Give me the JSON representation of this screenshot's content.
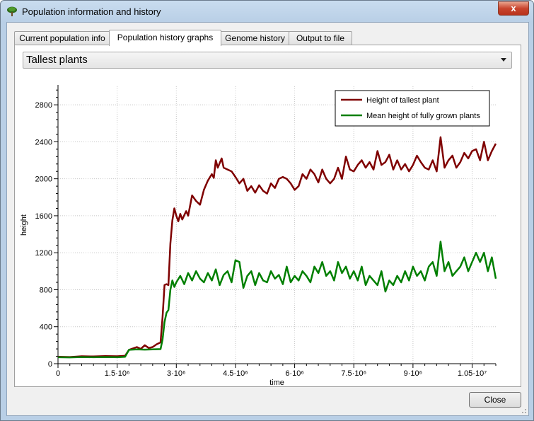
{
  "window": {
    "title": "Population information and history",
    "close_symbol": "x"
  },
  "tabs": [
    {
      "label": "Current population info",
      "active": false
    },
    {
      "label": "Population history graphs",
      "active": true
    },
    {
      "label": "Genome history",
      "active": false
    },
    {
      "label": "Output to file",
      "active": false
    }
  ],
  "graph_selector": {
    "selected": "Tallest plants"
  },
  "buttons": {
    "close": "Close"
  },
  "chart_data": {
    "type": "line",
    "xlabel": "time",
    "ylabel": "height",
    "xlim": [
      0,
      11100000
    ],
    "ylim": [
      0,
      3000
    ],
    "x_ticks": [
      {
        "value": 0,
        "label": "0"
      },
      {
        "value": 1500000,
        "label": "1.5·10⁶"
      },
      {
        "value": 3000000,
        "label": "3·10⁶"
      },
      {
        "value": 4500000,
        "label": "4.5·10⁶"
      },
      {
        "value": 6000000,
        "label": "6·10⁶"
      },
      {
        "value": 7500000,
        "label": "7.5·10⁶"
      },
      {
        "value": 9000000,
        "label": "9·10⁶"
      },
      {
        "value": 10500000,
        "label": "1.05·10⁷"
      }
    ],
    "y_ticks": [
      0,
      400,
      800,
      1200,
      1600,
      2000,
      2400,
      2800
    ],
    "grid": true,
    "legend_position": "top-right",
    "series": [
      {
        "name": "Height of tallest plant",
        "color": "#7f0000",
        "points": [
          [
            0,
            75
          ],
          [
            300000,
            72
          ],
          [
            600000,
            80
          ],
          [
            900000,
            78
          ],
          [
            1200000,
            82
          ],
          [
            1500000,
            80
          ],
          [
            1700000,
            85
          ],
          [
            1800000,
            150
          ],
          [
            2000000,
            180
          ],
          [
            2100000,
            160
          ],
          [
            2200000,
            200
          ],
          [
            2300000,
            170
          ],
          [
            2400000,
            180
          ],
          [
            2500000,
            210
          ],
          [
            2600000,
            230
          ],
          [
            2650000,
            500
          ],
          [
            2700000,
            850
          ],
          [
            2750000,
            860
          ],
          [
            2800000,
            850
          ],
          [
            2850000,
            1300
          ],
          [
            2900000,
            1550
          ],
          [
            2950000,
            1680
          ],
          [
            3000000,
            1600
          ],
          [
            3050000,
            1540
          ],
          [
            3100000,
            1620
          ],
          [
            3150000,
            1560
          ],
          [
            3250000,
            1650
          ],
          [
            3300000,
            1600
          ],
          [
            3400000,
            1820
          ],
          [
            3500000,
            1760
          ],
          [
            3600000,
            1720
          ],
          [
            3700000,
            1880
          ],
          [
            3800000,
            1980
          ],
          [
            3900000,
            2050
          ],
          [
            3950000,
            2010
          ],
          [
            4000000,
            2200
          ],
          [
            4050000,
            2120
          ],
          [
            4150000,
            2220
          ],
          [
            4200000,
            2120
          ],
          [
            4300000,
            2100
          ],
          [
            4400000,
            2080
          ],
          [
            4500000,
            2020
          ],
          [
            4600000,
            1950
          ],
          [
            4700000,
            2000
          ],
          [
            4800000,
            1870
          ],
          [
            4900000,
            1920
          ],
          [
            5000000,
            1850
          ],
          [
            5100000,
            1930
          ],
          [
            5200000,
            1870
          ],
          [
            5300000,
            1840
          ],
          [
            5400000,
            1950
          ],
          [
            5500000,
            1900
          ],
          [
            5600000,
            2000
          ],
          [
            5700000,
            2020
          ],
          [
            5800000,
            2000
          ],
          [
            5900000,
            1950
          ],
          [
            6000000,
            1880
          ],
          [
            6100000,
            1920
          ],
          [
            6200000,
            2050
          ],
          [
            6300000,
            2000
          ],
          [
            6400000,
            2100
          ],
          [
            6500000,
            2050
          ],
          [
            6600000,
            1960
          ],
          [
            6700000,
            2100
          ],
          [
            6800000,
            2000
          ],
          [
            6900000,
            1950
          ],
          [
            7000000,
            2000
          ],
          [
            7100000,
            2120
          ],
          [
            7200000,
            2000
          ],
          [
            7300000,
            2240
          ],
          [
            7400000,
            2100
          ],
          [
            7500000,
            2080
          ],
          [
            7600000,
            2150
          ],
          [
            7700000,
            2200
          ],
          [
            7800000,
            2120
          ],
          [
            7900000,
            2180
          ],
          [
            8000000,
            2100
          ],
          [
            8100000,
            2300
          ],
          [
            8200000,
            2150
          ],
          [
            8300000,
            2180
          ],
          [
            8400000,
            2260
          ],
          [
            8500000,
            2100
          ],
          [
            8600000,
            2200
          ],
          [
            8700000,
            2100
          ],
          [
            8800000,
            2160
          ],
          [
            8900000,
            2080
          ],
          [
            9000000,
            2150
          ],
          [
            9100000,
            2250
          ],
          [
            9200000,
            2180
          ],
          [
            9300000,
            2120
          ],
          [
            9400000,
            2100
          ],
          [
            9500000,
            2200
          ],
          [
            9600000,
            2080
          ],
          [
            9700000,
            2450
          ],
          [
            9800000,
            2120
          ],
          [
            9900000,
            2200
          ],
          [
            10000000,
            2250
          ],
          [
            10100000,
            2120
          ],
          [
            10200000,
            2180
          ],
          [
            10300000,
            2280
          ],
          [
            10400000,
            2220
          ],
          [
            10500000,
            2300
          ],
          [
            10600000,
            2320
          ],
          [
            10700000,
            2200
          ],
          [
            10800000,
            2400
          ],
          [
            10900000,
            2200
          ],
          [
            11000000,
            2300
          ],
          [
            11100000,
            2380
          ]
        ]
      },
      {
        "name": "Mean height of fully grown plants",
        "color": "#007f00",
        "points": [
          [
            0,
            70
          ],
          [
            300000,
            68
          ],
          [
            600000,
            72
          ],
          [
            900000,
            70
          ],
          [
            1200000,
            72
          ],
          [
            1500000,
            70
          ],
          [
            1700000,
            75
          ],
          [
            1800000,
            150
          ],
          [
            2000000,
            155
          ],
          [
            2200000,
            152
          ],
          [
            2400000,
            155
          ],
          [
            2600000,
            158
          ],
          [
            2650000,
            260
          ],
          [
            2700000,
            450
          ],
          [
            2750000,
            550
          ],
          [
            2800000,
            580
          ],
          [
            2850000,
            800
          ],
          [
            2900000,
            900
          ],
          [
            2950000,
            830
          ],
          [
            3000000,
            880
          ],
          [
            3100000,
            950
          ],
          [
            3200000,
            860
          ],
          [
            3300000,
            980
          ],
          [
            3400000,
            900
          ],
          [
            3500000,
            1000
          ],
          [
            3600000,
            920
          ],
          [
            3700000,
            880
          ],
          [
            3800000,
            980
          ],
          [
            3900000,
            900
          ],
          [
            4000000,
            1020
          ],
          [
            4100000,
            850
          ],
          [
            4200000,
            960
          ],
          [
            4300000,
            1000
          ],
          [
            4400000,
            880
          ],
          [
            4500000,
            1120
          ],
          [
            4600000,
            1100
          ],
          [
            4700000,
            820
          ],
          [
            4800000,
            950
          ],
          [
            4900000,
            1000
          ],
          [
            5000000,
            850
          ],
          [
            5100000,
            980
          ],
          [
            5200000,
            900
          ],
          [
            5300000,
            880
          ],
          [
            5400000,
            1000
          ],
          [
            5500000,
            920
          ],
          [
            5600000,
            960
          ],
          [
            5700000,
            860
          ],
          [
            5800000,
            1050
          ],
          [
            5900000,
            880
          ],
          [
            6000000,
            950
          ],
          [
            6100000,
            900
          ],
          [
            6200000,
            1000
          ],
          [
            6300000,
            950
          ],
          [
            6400000,
            880
          ],
          [
            6500000,
            1050
          ],
          [
            6600000,
            980
          ],
          [
            6700000,
            1100
          ],
          [
            6800000,
            950
          ],
          [
            6900000,
            1000
          ],
          [
            7000000,
            900
          ],
          [
            7100000,
            1100
          ],
          [
            7200000,
            980
          ],
          [
            7300000,
            1050
          ],
          [
            7400000,
            920
          ],
          [
            7500000,
            1000
          ],
          [
            7600000,
            900
          ],
          [
            7700000,
            1050
          ],
          [
            7800000,
            850
          ],
          [
            7900000,
            950
          ],
          [
            8000000,
            900
          ],
          [
            8100000,
            850
          ],
          [
            8200000,
            1000
          ],
          [
            8300000,
            780
          ],
          [
            8400000,
            900
          ],
          [
            8500000,
            850
          ],
          [
            8600000,
            950
          ],
          [
            8700000,
            880
          ],
          [
            8800000,
            1000
          ],
          [
            8900000,
            900
          ],
          [
            9000000,
            1050
          ],
          [
            9100000,
            950
          ],
          [
            9200000,
            1000
          ],
          [
            9300000,
            900
          ],
          [
            9400000,
            1050
          ],
          [
            9500000,
            1100
          ],
          [
            9600000,
            950
          ],
          [
            9700000,
            1320
          ],
          [
            9800000,
            1000
          ],
          [
            9900000,
            1100
          ],
          [
            10000000,
            950
          ],
          [
            10100000,
            1000
          ],
          [
            10200000,
            1050
          ],
          [
            10300000,
            1150
          ],
          [
            10400000,
            1000
          ],
          [
            10500000,
            1100
          ],
          [
            10600000,
            1200
          ],
          [
            10700000,
            1100
          ],
          [
            10800000,
            1200
          ],
          [
            10900000,
            1000
          ],
          [
            11000000,
            1150
          ],
          [
            11100000,
            920
          ]
        ]
      }
    ]
  }
}
